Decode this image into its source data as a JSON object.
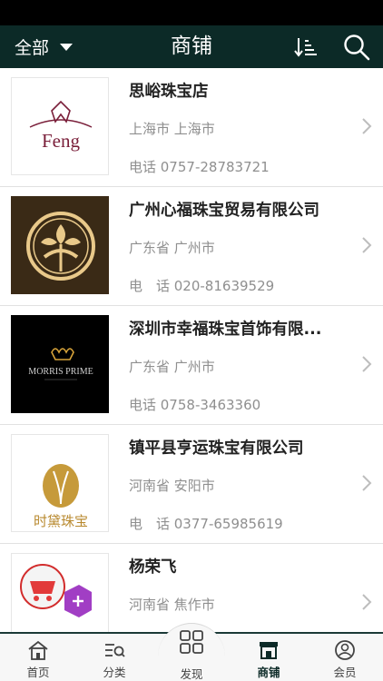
{
  "header": {
    "filter_label": "全部",
    "title": "商铺",
    "sort_icon": "sort-icon",
    "search_icon": "search-icon",
    "bg_color": "#0c2a27"
  },
  "shops": [
    {
      "name": "思峪珠宝店",
      "region": "上海市 上海市",
      "phone": "电话 0757-28783721",
      "logo_text": "Feng"
    },
    {
      "name": "广州心福珠宝贸易有限公司",
      "region": "广东省 广州市",
      "phone": "电　话 020-81639529"
    },
    {
      "name": "深圳市幸福珠宝首饰有限...",
      "region": "广东省 广州市",
      "phone": "电话 0758-3463360",
      "logo_text": "MORRIS PRIME"
    },
    {
      "name": "镇平县亨运珠宝有限公司",
      "region": "河南省 安阳市",
      "phone": "电　话 0377-65985619",
      "logo_text": "时黛珠宝"
    },
    {
      "name": "杨荣飞",
      "region": "河南省 焦作市",
      "phone": ""
    }
  ],
  "tabbar": {
    "items": [
      {
        "label": "首页",
        "icon": "home-icon"
      },
      {
        "label": "分类",
        "icon": "category-icon"
      },
      {
        "label": "发现",
        "icon": "discover-grid-icon"
      },
      {
        "label": "商铺",
        "icon": "shop-icon",
        "active": true
      },
      {
        "label": "会员",
        "icon": "member-icon"
      }
    ]
  }
}
